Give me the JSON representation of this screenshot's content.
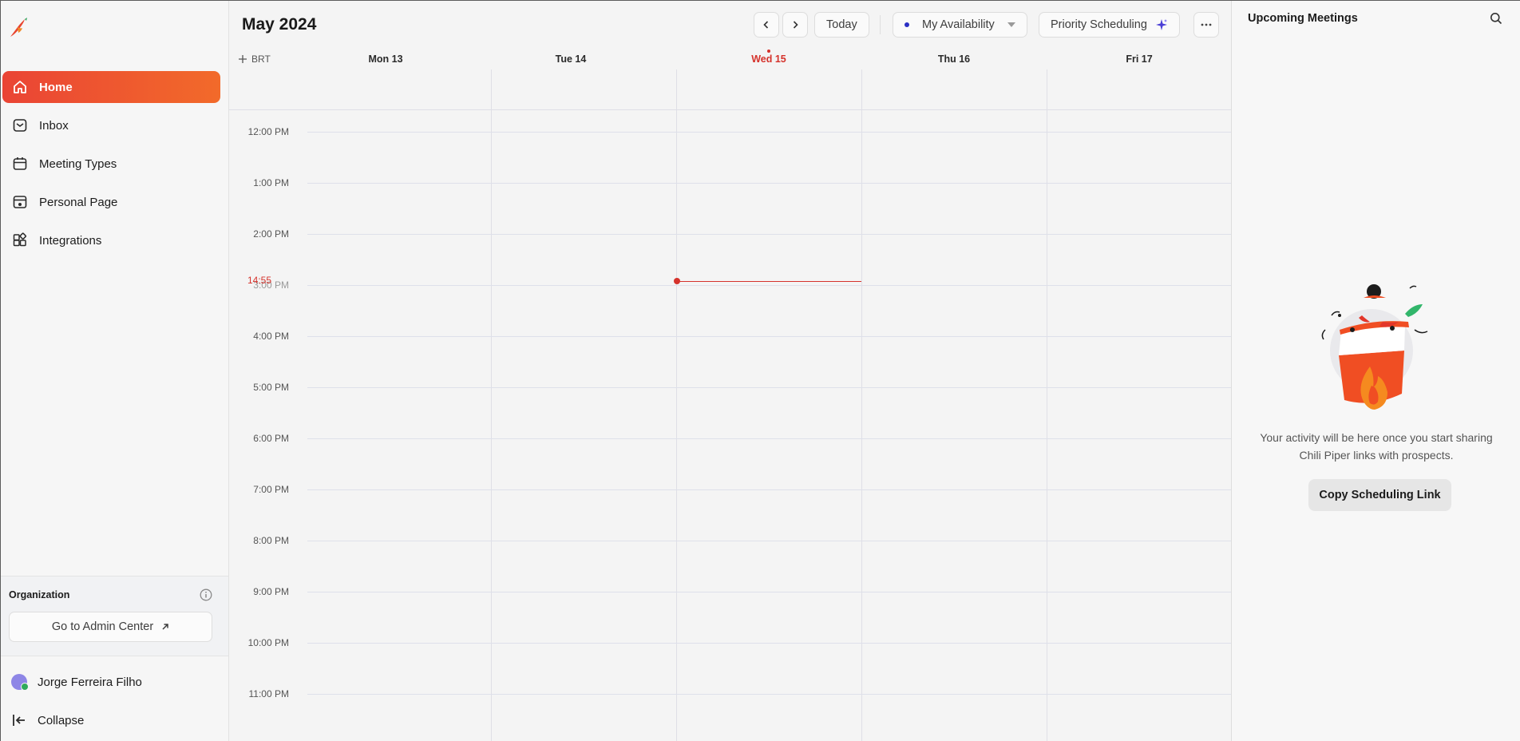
{
  "sidebar": {
    "logo_icon": "chili-pepper-logo",
    "nav": [
      {
        "label": "Home",
        "icon": "home-icon",
        "active": true
      },
      {
        "label": "Inbox",
        "icon": "inbox-icon"
      },
      {
        "label": "Meeting Types",
        "icon": "calendar-icon"
      },
      {
        "label": "Personal Page",
        "icon": "personal-page-icon"
      },
      {
        "label": "Integrations",
        "icon": "integrations-icon"
      }
    ],
    "organization": {
      "title": "Organization",
      "admin_button": "Go to Admin Center"
    },
    "user_name": "Jorge Ferreira Filho",
    "collapse_label": "Collapse"
  },
  "calendar": {
    "month_title": "May 2024",
    "today_label": "Today",
    "availability_label": "My Availability",
    "priority_label": "Priority Scheduling",
    "timezone_label": "BRT",
    "days": [
      {
        "label": "Mon 13"
      },
      {
        "label": "Tue 14"
      },
      {
        "label": "Wed 15",
        "today": true
      },
      {
        "label": "Thu 16"
      },
      {
        "label": "Fri 17"
      }
    ],
    "hours": [
      "12:00 PM",
      "1:00 PM",
      "2:00 PM",
      "3:00 PM",
      "4:00 PM",
      "5:00 PM",
      "6:00 PM",
      "7:00 PM",
      "8:00 PM",
      "9:00 PM",
      "10:00 PM",
      "11:00 PM"
    ],
    "current_time": "14:55",
    "colors": {
      "accent": "#d5322b",
      "availability_dot": "#2b2fc4"
    }
  },
  "panel": {
    "title": "Upcoming Meetings",
    "empty_text_line1": "Your activity will be here once you start sharing",
    "empty_text_line2": "Chili Piper links with prospects.",
    "copy_button": "Copy Scheduling Link"
  }
}
